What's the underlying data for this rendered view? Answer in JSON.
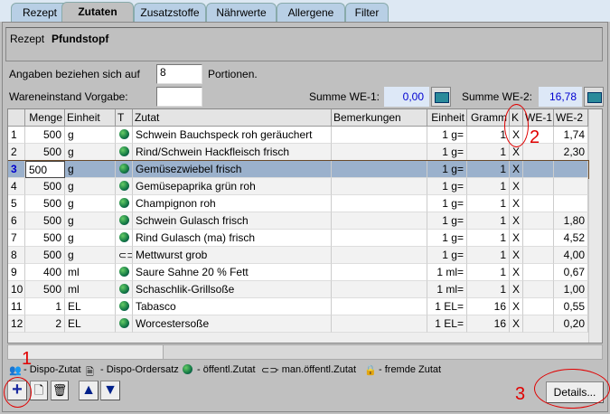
{
  "tabs": [
    "Rezept",
    "Zutaten",
    "Zusatzstoffe",
    "Nährwerte",
    "Allergene",
    "Filter"
  ],
  "active_tab": "Zutaten",
  "recipe": {
    "label": "Rezept",
    "name": "Pfundstopf"
  },
  "portions": {
    "label": "Angaben beziehen sich auf",
    "value": "8",
    "suffix": "Portionen."
  },
  "wareneinstand": {
    "label": "Wareneinstand Vorgabe:",
    "value": ""
  },
  "sum_we1": {
    "label": "Summe WE-1:",
    "value": "0,00"
  },
  "sum_we2": {
    "label": "Summe WE-2:",
    "value": "16,78"
  },
  "columns": [
    "",
    "Menge",
    "Einheit",
    "T",
    "Zutat",
    "Bemerkungen",
    "Einheit",
    "Gramm",
    "K",
    "WE-1",
    "WE-2"
  ],
  "rows": [
    [
      "1",
      "500",
      "g",
      "globe",
      "Schwein Bauchspeck roh geräuchert",
      "",
      "1 g=",
      "1",
      "X",
      "",
      "1,74"
    ],
    [
      "2",
      "500",
      "g",
      "globe",
      "Rind/Schwein Hackfleisch frisch",
      "",
      "1 g=",
      "1",
      "X",
      "",
      "2,30"
    ],
    [
      "3",
      "500",
      "g",
      "globe",
      "Gemüsezwiebel frisch",
      "",
      "1 g=",
      "1",
      "X",
      "",
      ""
    ],
    [
      "4",
      "500",
      "g",
      "globe",
      "Gemüsepaprika grün roh",
      "",
      "1 g=",
      "1",
      "X",
      "",
      ""
    ],
    [
      "5",
      "500",
      "g",
      "globe",
      "Champignon roh",
      "",
      "1 g=",
      "1",
      "X",
      "",
      ""
    ],
    [
      "6",
      "500",
      "g",
      "globe",
      "Schwein Gulasch frisch",
      "",
      "1 g=",
      "1",
      "X",
      "",
      "1,80"
    ],
    [
      "7",
      "500",
      "g",
      "globe",
      "Rind Gulasch (ma) frisch",
      "",
      "1 g=",
      "1",
      "X",
      "",
      "4,52"
    ],
    [
      "8",
      "500",
      "g",
      "link",
      "Mettwurst grob",
      "",
      "1 g=",
      "1",
      "X",
      "",
      "4,00"
    ],
    [
      "9",
      "400",
      "ml",
      "globe",
      "Saure Sahne 20 % Fett",
      "",
      "1 ml=",
      "1",
      "X",
      "",
      "0,67"
    ],
    [
      "10",
      "500",
      "ml",
      "globe",
      "Schaschlik-Grillsoße",
      "",
      "1 ml=",
      "1",
      "X",
      "",
      "1,00"
    ],
    [
      "11",
      "1",
      "EL",
      "globe",
      "Tabasco",
      "",
      "1 EL=",
      "16",
      "X",
      "",
      "0,55"
    ],
    [
      "12",
      "2",
      "EL",
      "globe",
      "Worcestersoße",
      "",
      "1 EL=",
      "16",
      "X",
      "",
      "0,20"
    ]
  ],
  "selected_row": 2,
  "legend": [
    "- Dispo-Zutat",
    "- Dispo-Ordersatz",
    "- öffentl.Zutat",
    "- man.öffentl.Zutat",
    "- fremde Zutat"
  ],
  "details_button": "Details...",
  "annotations": [
    "1",
    "2",
    "3"
  ]
}
